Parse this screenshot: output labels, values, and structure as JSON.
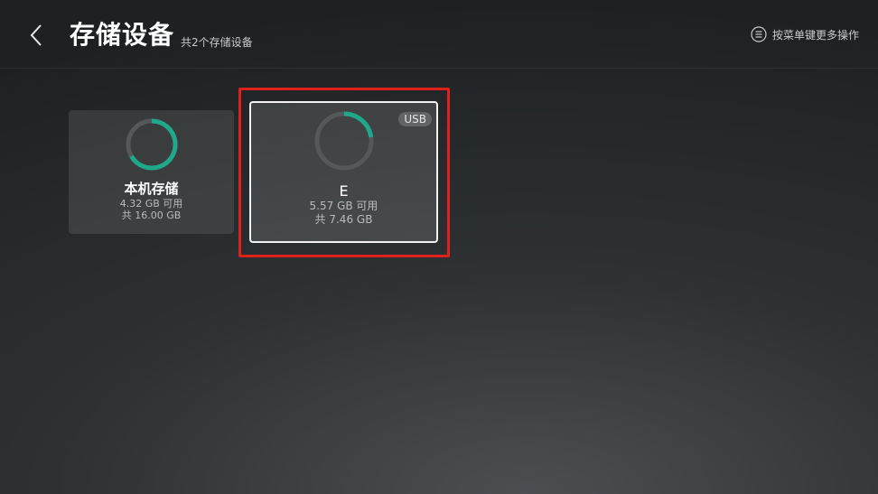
{
  "header": {
    "title": "存储设备",
    "subtitle": "共2个存储设备",
    "menu_hint": "按菜单键更多操作",
    "back_icon": "chevron-left-icon",
    "menu_icon": "menu-circle-icon"
  },
  "colors": {
    "accent": "#1fa88a",
    "ring_track": "#54585b",
    "focus_frame": "#e0211b",
    "card_border": "#f2f2f2"
  },
  "devices": [
    {
      "name": "本机存储",
      "available": "4.32 GB 可用",
      "total": "共 16.00 GB",
      "badge": "",
      "focused": false
    },
    {
      "name": "E",
      "available": "5.57 GB 可用",
      "total": "共 7.46 GB",
      "badge": "USB",
      "focused": true
    }
  ]
}
